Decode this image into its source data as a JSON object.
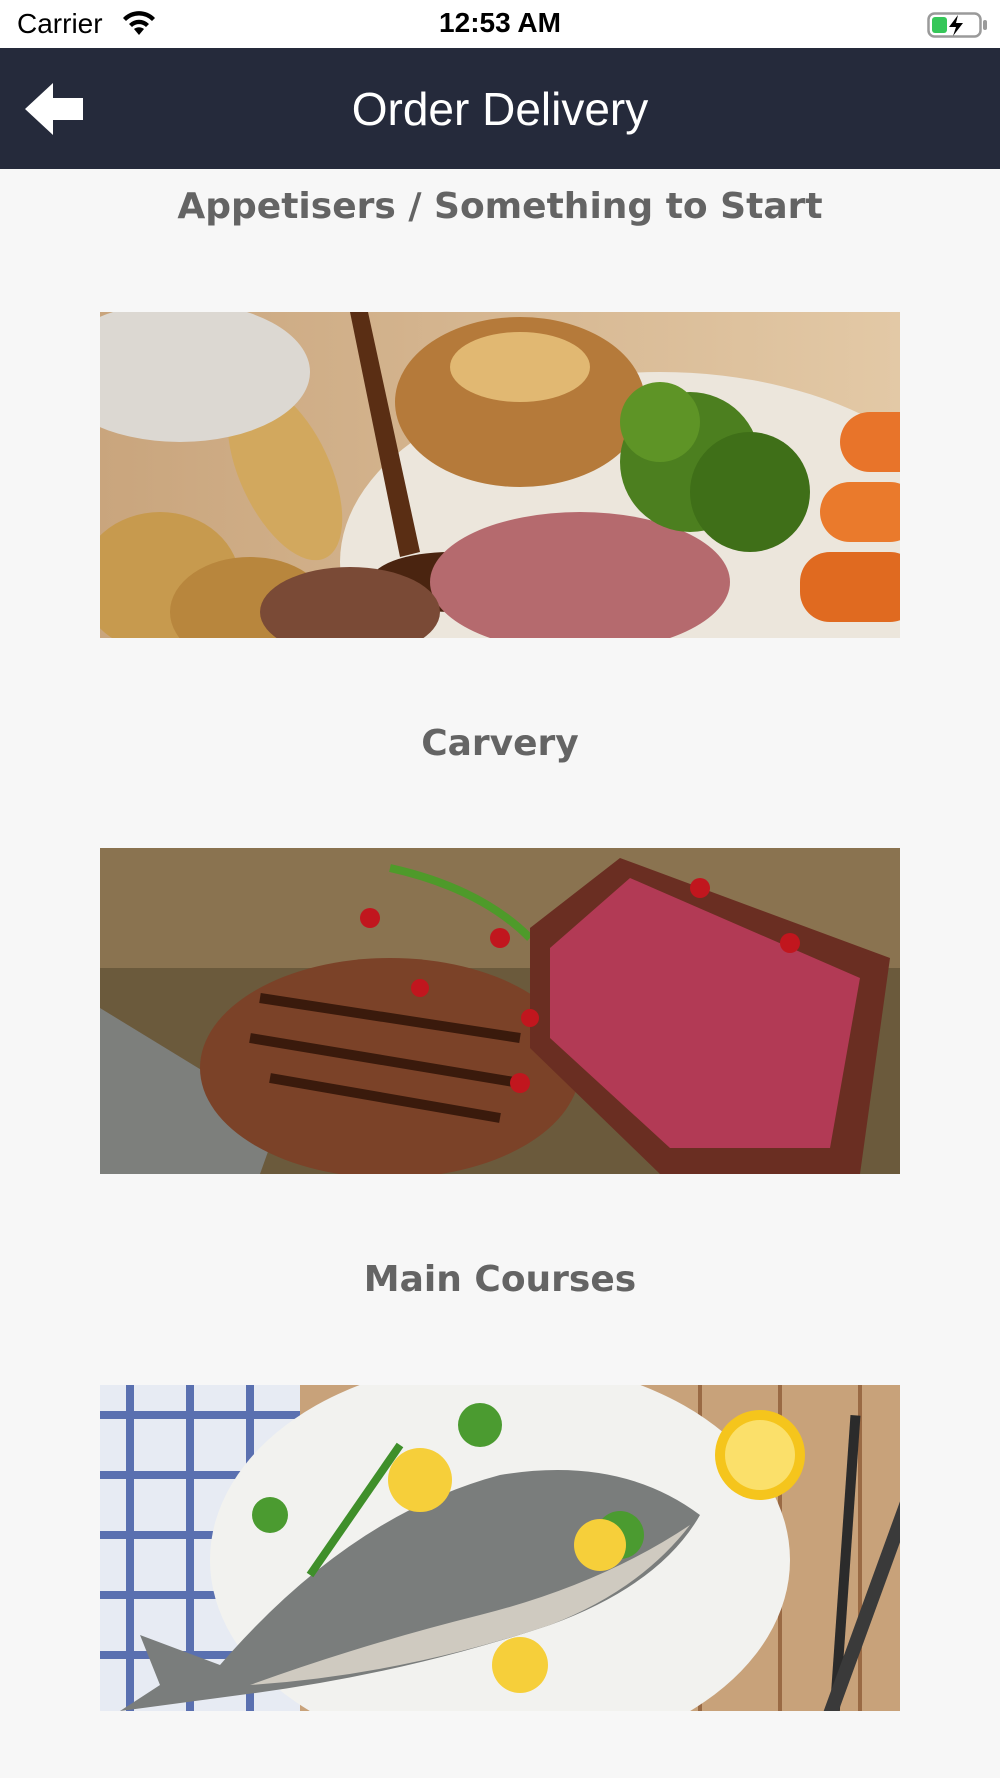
{
  "status_bar": {
    "carrier": "Carrier",
    "time": "12:53 AM",
    "icons": [
      "wifi-icon",
      "battery-charging-icon"
    ]
  },
  "nav": {
    "title": "Order Delivery",
    "back_icon": "back-arrow-icon"
  },
  "sections": [
    {
      "title": "Appetisers / Something to Start",
      "image": "roast-dinner-photo"
    },
    {
      "title": "Carvery",
      "image": "steak-photo"
    },
    {
      "title": "Main Courses",
      "image": "grilled-fish-photo"
    }
  ]
}
